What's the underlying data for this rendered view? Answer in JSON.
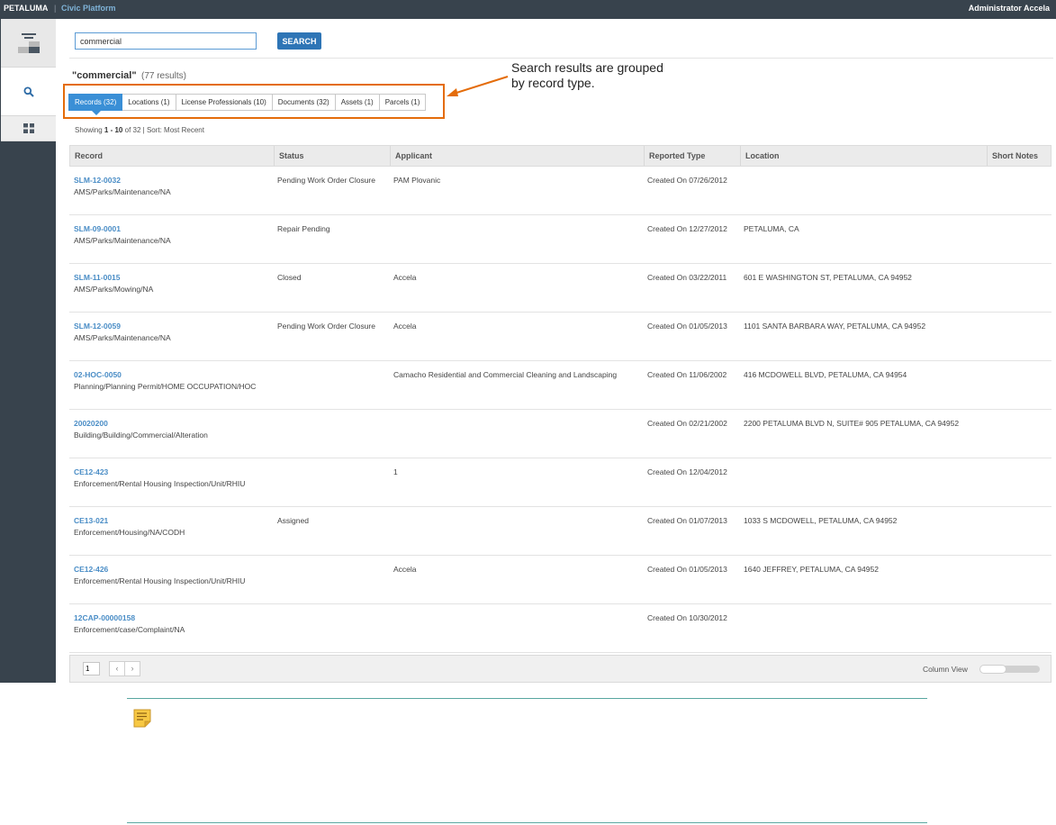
{
  "header": {
    "brand": "PETALUMA",
    "separator": "|",
    "platform": "Civic Platform",
    "user": "Administrator Accela"
  },
  "leftnav": {
    "items": [
      {
        "icon": "dashboard-icon"
      },
      {
        "icon": "search-icon"
      },
      {
        "icon": "apps-grid-icon"
      }
    ]
  },
  "search": {
    "value": "commercial",
    "button_label": "SEARCH"
  },
  "results": {
    "query": "\"commercial\"",
    "count": "(77 results)",
    "showing_prefix": "Showing",
    "showing_range": "1 - 10",
    "showing_suffix": "of 32 | Sort: Most Recent"
  },
  "tabs": [
    {
      "label": "Records (32)",
      "active": true
    },
    {
      "label": "Locations (1)"
    },
    {
      "label": "License Professionals (10)"
    },
    {
      "label": "Documents (32)"
    },
    {
      "label": "Assets (1)"
    },
    {
      "label": "Parcels (1)"
    }
  ],
  "callout": {
    "line1": "Search results are grouped",
    "line2": "by record type.",
    "color": "#e46c0a"
  },
  "table": {
    "columns": [
      "Record",
      "Status",
      "Applicant",
      "Reported Type",
      "Location",
      "Short Notes"
    ],
    "rows": [
      {
        "id": "SLM-12-0032",
        "type": "AMS/Parks/Maintenance/NA",
        "status": "Pending Work Order Closure",
        "applicant": "PAM Plovanic",
        "reported": "Created On 07/26/2012",
        "location": "",
        "notes": ""
      },
      {
        "id": "SLM-09-0001",
        "type": "AMS/Parks/Maintenance/NA",
        "status": "Repair Pending",
        "applicant": "",
        "reported": "Created On 12/27/2012",
        "location": "PETALUMA, CA",
        "notes": ""
      },
      {
        "id": "SLM-11-0015",
        "type": "AMS/Parks/Mowing/NA",
        "status": "Closed",
        "applicant": "Accela",
        "reported": "Created On 03/22/2011",
        "location": "601 E WASHINGTON ST, PETALUMA, CA 94952",
        "notes": ""
      },
      {
        "id": "SLM-12-0059",
        "type": "AMS/Parks/Maintenance/NA",
        "status": "Pending Work Order Closure",
        "applicant": "Accela",
        "reported": "Created On 01/05/2013",
        "location": "1101 SANTA BARBARA WAY, PETALUMA, CA 94952",
        "notes": ""
      },
      {
        "id": "02-HOC-0050",
        "type": "Planning/Planning Permit/HOME OCCUPATION/HOC",
        "status": "",
        "applicant": "Camacho Residential and Commercial Cleaning and Landscaping",
        "reported": "Created On 11/06/2002",
        "location": "416 MCDOWELL BLVD, PETALUMA, CA 94954",
        "notes": ""
      },
      {
        "id": "20020200",
        "type": "Building/Building/Commercial/Alteration",
        "status": "",
        "applicant": "",
        "reported": "Created On 02/21/2002",
        "location": "2200 PETALUMA BLVD N, SUITE# 905 PETALUMA, CA 94952",
        "notes": ""
      },
      {
        "id": "CE12-423",
        "type": "Enforcement/Rental Housing Inspection/Unit/RHIU",
        "status": "",
        "applicant": "1",
        "reported": "Created On 12/04/2012",
        "location": "",
        "notes": ""
      },
      {
        "id": "CE13-021",
        "type": "Enforcement/Housing/NA/CODH",
        "status": "Assigned",
        "applicant": "",
        "reported": "Created On 01/07/2013",
        "location": "1033 S MCDOWELL, PETALUMA, CA 94952",
        "notes": ""
      },
      {
        "id": "CE12-426",
        "type": "Enforcement/Rental Housing Inspection/Unit/RHIU",
        "status": "",
        "applicant": "Accela",
        "reported": "Created On 01/05/2013",
        "location": "1640 JEFFREY, PETALUMA, CA 94952",
        "notes": ""
      },
      {
        "id": "12CAP-00000158",
        "type": "Enforcement/case/Complaint/NA",
        "status": "",
        "applicant": "",
        "reported": "Created On 10/30/2012",
        "location": "",
        "notes": ""
      }
    ]
  },
  "pager": {
    "page": "1",
    "prev": "‹",
    "next": "›",
    "column_view_label": "Column View"
  },
  "note": {
    "icon": "note-icon"
  }
}
